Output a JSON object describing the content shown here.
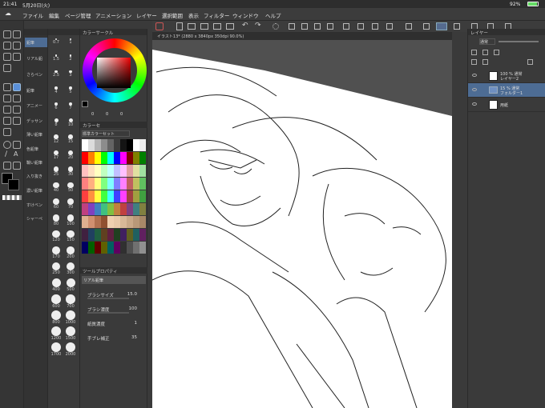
{
  "status": {
    "time": "21:41",
    "date": "5月20日(火)",
    "battery": "92%"
  },
  "menu": [
    "ファイル",
    "編集",
    "ページ管理",
    "アニメーション",
    "レイヤー",
    "選択範囲",
    "表示",
    "フィルター",
    "ウィンドウ",
    "ヘルプ"
  ],
  "canvas_tab": "イラスト13* (2880 x 3840px 350dpi 90.0%)",
  "panels": {
    "color_circle": "カラーサークル",
    "color_set": "カラーセ",
    "color_set_name": "標準カラーセット",
    "tool_property": "ツールプロパティ",
    "layer": "レイヤー",
    "blend_mode": "通常"
  },
  "sub_tools": [
    "鉛筆",
    "リアル鉛",
    "さらペン",
    "",
    "鉛筆",
    "アニメー",
    "デッサン",
    "薄い鉛筆",
    "色鉛筆",
    "鞘い鉛筆",
    "入り抜き",
    "濃い鉛筆",
    "すけべン",
    "シャーペ"
  ],
  "sizes": [
    [
      "0.7",
      "1"
    ],
    [
      "1.5",
      "2"
    ],
    [
      "2.5",
      "3"
    ],
    [
      "4",
      "5"
    ],
    [
      "6",
      "7"
    ],
    [
      "8",
      "10"
    ],
    [
      "12",
      "15"
    ],
    [
      "17",
      "20"
    ],
    [
      "25",
      "30"
    ],
    [
      "40",
      "50"
    ],
    [
      "60",
      "70"
    ],
    [
      "80",
      "100"
    ],
    [
      "120",
      "150"
    ],
    [
      "170",
      "200"
    ],
    [
      "250",
      "300"
    ],
    [
      "400",
      "500"
    ],
    [
      "600",
      "700"
    ],
    [
      "800",
      "1000"
    ],
    [
      "1200",
      "1500"
    ],
    [
      "1700",
      "2000"
    ]
  ],
  "color_values": {
    "r": "0",
    "g": "0",
    "b": "0"
  },
  "tool_property": {
    "brush_name": "リアル鉛筆",
    "brush_size_label": "ブラシサイズ",
    "brush_size": "15.0",
    "brush_density_label": "ブラシ濃度",
    "brush_density": "100",
    "paper_texture_label": "紙質濃度",
    "paper_texture": "1",
    "stabilization_label": "手ブレ補正",
    "stabilization": "35"
  },
  "layer_controls": {
    "opacity": "100"
  },
  "layers": [
    {
      "opacity": "100 % 通常",
      "name": "レイヤー2"
    },
    {
      "opacity": "15 % 通常",
      "name": "フォルダー1"
    },
    {
      "opacity": "",
      "name": "用紙"
    }
  ],
  "colors": {
    "bg": "#3a3a3a",
    "accent": "#5a8fd8",
    "main_color": "#000000",
    "sub_color": "#ffffff"
  }
}
